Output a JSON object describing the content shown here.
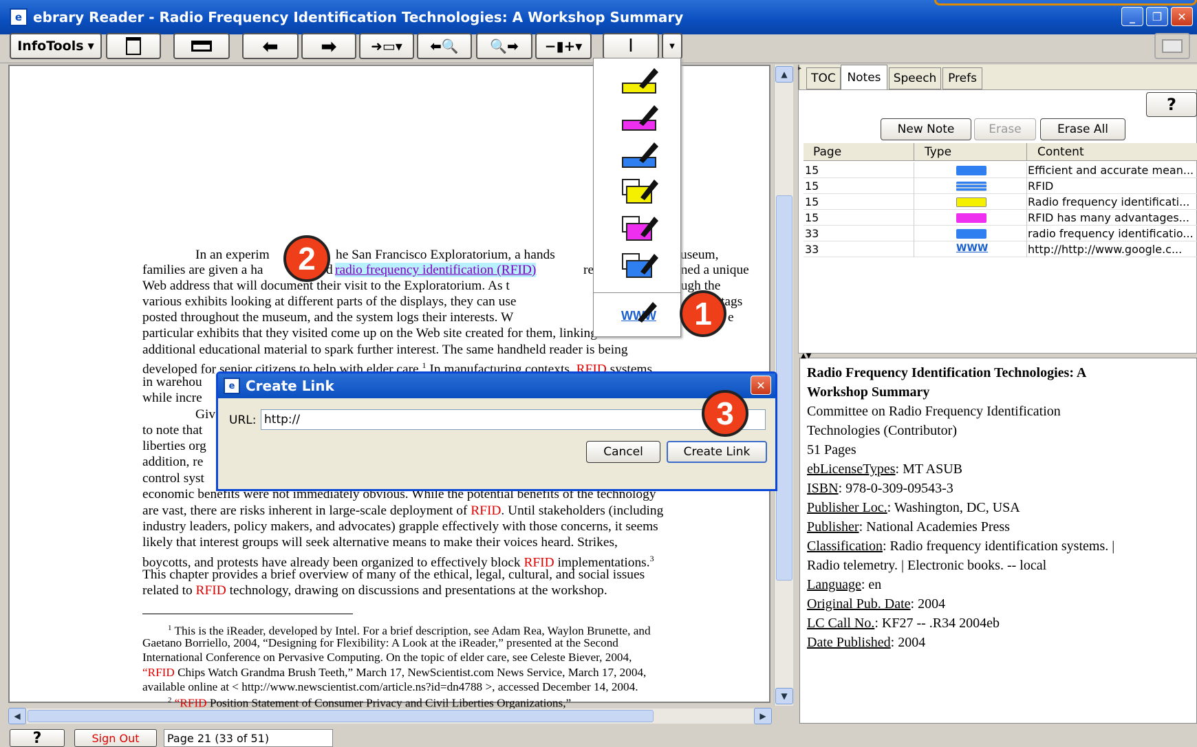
{
  "window": {
    "title": "ebrary Reader - Radio Frequency Identification Technologies: A Workshop Summary",
    "icon": "e-icon"
  },
  "toolbar": {
    "infotools_label": "InfoTools"
  },
  "highlight_colors": {
    "yellow": "#f5f000",
    "magenta": "#ef2fef",
    "blue": "#2f7ff0"
  },
  "document": {
    "lines": [
      "In an experim",
      "he San Francisco Exploratorium, a hands",
      "useum,",
      "families are given a ha",
      "d",
      "radio frequency identification (RFID)",
      "re",
      "gned a unique",
      "Web address that will document their visit to the Exploratorium.  As t",
      "ough the",
      "various exhibits looking at different parts of the displays, they can use",
      "tags",
      "posted throughout the museum, and the system logs their interests.  W",
      "e",
      "particular exhibits that they visited come up on the Web site created for them, linking to",
      "additional educational material to spark further interest. The same handheld reader is being",
      "developed for senior citizens to help with elder care.",
      "1",
      "  In manufacturing contexts,",
      "RFID",
      " systems",
      "in warehou",
      "while incre",
      "Giv",
      "to note that",
      "liberties org",
      "addition, re",
      "control syst",
      "economic benefits were not immediately obvious. While the potential benefits of the technology",
      "are vast, there are risks inherent in large-scale deployment of",
      ". Until stakeholders (including",
      "industry leaders, policy makers, and advocates) grapple effectively with those concerns, it seems",
      "likely that interest groups will seek alternative means to make their voices heard. Strikes,",
      "boycotts, and protests have already been organized to effectively block",
      " implementations.",
      "3",
      "This chapter provides a brief overview of many of the ethical, legal, cultural, and social issues",
      "related to",
      " technology, drawing on discussions and presentations at the workshop."
    ],
    "footnotes": [
      "1",
      " This is the iReader, developed by Intel.  For a brief description, see Adam Rea, Waylon Brunette, and",
      "Gaetano Borriello, 2004, “Designing for Flexibility: A Look at the iReader,” presented at the Second",
      "International Conference on Pervasive Computing. On the topic of elder care, see Celeste Biever, 2004,",
      "“RFID",
      " Chips Watch Grandma Brush Teeth,” March 17, NewScientist.com News Service, March 17, 2004,",
      "available online at < http://www.newscientist.com/article.ns?id=dn4788 >, accessed December 14, 2004.",
      "2",
      " “RFID",
      " Position Statement of Consumer Privacy and Civil Liberties Organizations,”"
    ]
  },
  "dropdown": {
    "www_label": "WWW"
  },
  "dialog": {
    "title": "Create Link",
    "url_label": "URL:",
    "url_value": "http://",
    "cancel_label": "Cancel",
    "create_label": "Create Link"
  },
  "badges": [
    "1",
    "2",
    "3"
  ],
  "tabs": [
    "TOC",
    "Notes",
    "Speech",
    "Prefs"
  ],
  "notes": {
    "help_label": "?",
    "new_note": "New Note",
    "erase": "Erase",
    "erase_all": "Erase All",
    "columns": [
      "Page",
      "Type",
      "Content"
    ],
    "rows": [
      {
        "page": "15",
        "type": "blue-highlight",
        "color": "#2f7ff0",
        "content": "Efficient and accurate mean..."
      },
      {
        "page": "15",
        "type": "blue-note",
        "color": "#2f7ff0",
        "content": "RFID"
      },
      {
        "page": "15",
        "type": "yellow-highlight",
        "color": "#f5f000",
        "content": "Radio frequency identificati..."
      },
      {
        "page": "15",
        "type": "magenta-highlight",
        "color": "#ef2fef",
        "content": "RFID has many advantages..."
      },
      {
        "page": "33",
        "type": "blue-highlight",
        "color": "#2f7ff0",
        "content": "radio frequency identificatio..."
      },
      {
        "page": "33",
        "type": "www-link",
        "color": "#1a5fd0",
        "content": "http://http://www.google.c..."
      }
    ],
    "www_label": "WWW"
  },
  "info": {
    "title_lines": [
      "Radio Frequency Identification Technologies: A",
      "Workshop Summary"
    ],
    "author_lines": [
      "Committee on Radio Frequency Identification",
      "Technologies (Contributor)"
    ],
    "pages": "51 Pages",
    "fields": [
      {
        "label": "ebLicenseTypes",
        "value": " MT ASUB"
      },
      {
        "label": "ISBN",
        "value": " 978-0-309-09543-3"
      },
      {
        "label": "Publisher Loc.",
        "value": " Washington, DC, USA"
      },
      {
        "label": "Publisher",
        "value": " National Academies Press"
      },
      {
        "label": "Classification",
        "value": " Radio frequency identification systems. |"
      },
      {
        "label": "",
        "value": "Radio telemetry. | Electronic books. -- local"
      },
      {
        "label": "Language",
        "value": " en"
      },
      {
        "label": "Original Pub. Date",
        "value": " 2004"
      },
      {
        "label": "LC Call No.",
        "value": " KF27 -- .R34 2004eb"
      },
      {
        "label": "Date Published",
        "value": " 2004"
      }
    ]
  },
  "status": {
    "help_label": "?",
    "sign_out": "Sign Out",
    "page_info": "Page 21 (33 of 51)"
  }
}
